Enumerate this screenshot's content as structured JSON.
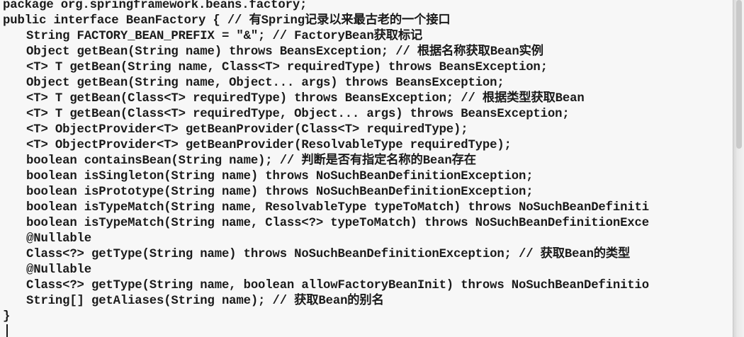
{
  "code": {
    "lines": [
      "package org.springframework.beans.factory;",
      "public interface BeanFactory { // 有Spring记录以来最古老的一个接口",
      "String FACTORY_BEAN_PREFIX = \"&\"; // FactoryBean获取标记",
      "Object getBean(String name) throws BeansException; // 根据名称获取Bean实例",
      "<T> T getBean(String name, Class<T> requiredType) throws BeansException;",
      "Object getBean(String name, Object... args) throws BeansException;",
      "<T> T getBean(Class<T> requiredType) throws BeansException; // 根据类型获取Bean",
      "<T> T getBean(Class<T> requiredType, Object... args) throws BeansException;",
      "<T> ObjectProvider<T> getBeanProvider(Class<T> requiredType);",
      "<T> ObjectProvider<T> getBeanProvider(ResolvableType requiredType);",
      "boolean containsBean(String name); // 判断是否有指定名称的Bean存在",
      "boolean isSingleton(String name) throws NoSuchBeanDefinitionException;",
      "boolean isPrototype(String name) throws NoSuchBeanDefinitionException;",
      "boolean isTypeMatch(String name, ResolvableType typeToMatch) throws NoSuchBeanDefiniti",
      "boolean isTypeMatch(String name, Class<?> typeToMatch) throws NoSuchBeanDefinitionExce",
      "@Nullable",
      "Class<?> getType(String name) throws NoSuchBeanDefinitionException; // 获取Bean的类型",
      "@Nullable",
      "Class<?> getType(String name, boolean allowFactoryBeanInit) throws NoSuchBeanDefinitio",
      "String[] getAliases(String name); // 获取Bean的别名",
      "}"
    ]
  }
}
